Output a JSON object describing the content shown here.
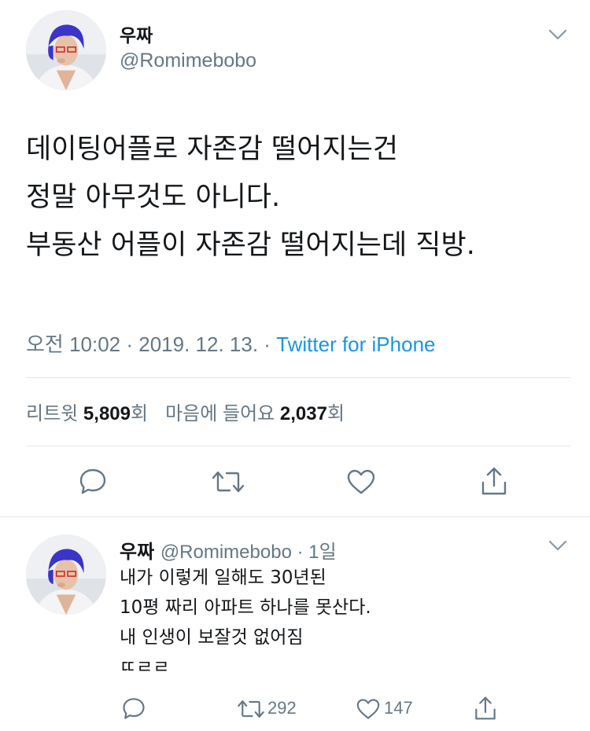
{
  "tweet": {
    "author_name": "우짜",
    "author_handle": "@Romimebobo",
    "lines": [
      "데이팅어플로 자존감 떨어지는건",
      "정말 아무것도 아니다.",
      "부동산 어플이 자존감 떨어지는데 직방."
    ],
    "time": "오전 10:02",
    "date": "2019. 12. 13.",
    "separator": " · ",
    "source": "Twitter for iPhone",
    "retweet_label": "리트윗",
    "retweet_count": "5,809",
    "retweet_suffix": "회",
    "like_label": "마음에 들어요",
    "like_count": "2,037",
    "like_suffix": "회"
  },
  "reply": {
    "author_name": "우짜",
    "author_handle": "@Romimebobo",
    "age_prefix": " · ",
    "age": "1일",
    "lines": [
      "내가 이렇게 일해도 30년된",
      "10평 짜리 아파트 하나를 못산다.",
      "내 인생이 보잘것 없어짐",
      "ㄸㄹㄹ"
    ],
    "retweet_count": "292",
    "like_count": "147"
  },
  "icons": {
    "reply": "comment-icon",
    "retweet": "retweet-icon",
    "like": "heart-icon",
    "share": "share-icon",
    "menu": "chevron-down-icon"
  },
  "colors": {
    "text": "#14171a",
    "secondary": "#657786",
    "link": "#1b95e0",
    "divider": "#e1e8ed"
  }
}
